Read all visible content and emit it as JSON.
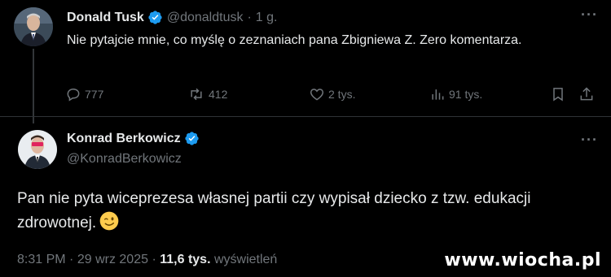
{
  "tweet1": {
    "author_name": "Donald Tusk",
    "handle": "@donaldtusk",
    "separator": "·",
    "time": "1 g.",
    "text": "Nie pytajcie mnie, co myślę o zeznaniach pana Zbigniewa Z. Zero komentarza.",
    "actions": {
      "replies": "777",
      "reposts": "412",
      "likes": "2 tys.",
      "views": "91 tys."
    }
  },
  "tweet2": {
    "author_name": "Konrad Berkowicz",
    "handle": "@KonradBerkowicz",
    "text": "Pan nie pyta wiceprezesa własnej partii czy wypisał dziecko z tzw. edukacji zdrowotnej.",
    "footer": {
      "time": "8:31 PM",
      "separator": "·",
      "date": "29 wrz 2025",
      "views_count": "11,6 tys.",
      "views_label": "wyświetleń"
    }
  },
  "more_menu_glyph": "···",
  "watermark": "www.wiocha.pl",
  "colors": {
    "background": "#000000",
    "primary_text": "#e7e9ea",
    "secondary_text": "#71767b",
    "verified_blue": "#1d9bf0",
    "divider": "#2f3336"
  },
  "icons": {
    "verified": "verified-badge-icon",
    "reply": "reply-icon",
    "repost": "repost-icon",
    "like": "heart-icon",
    "views": "views-chart-icon",
    "bookmark": "bookmark-icon",
    "share": "share-icon",
    "more": "more-icon",
    "emoji": "winking-face-emoji"
  }
}
